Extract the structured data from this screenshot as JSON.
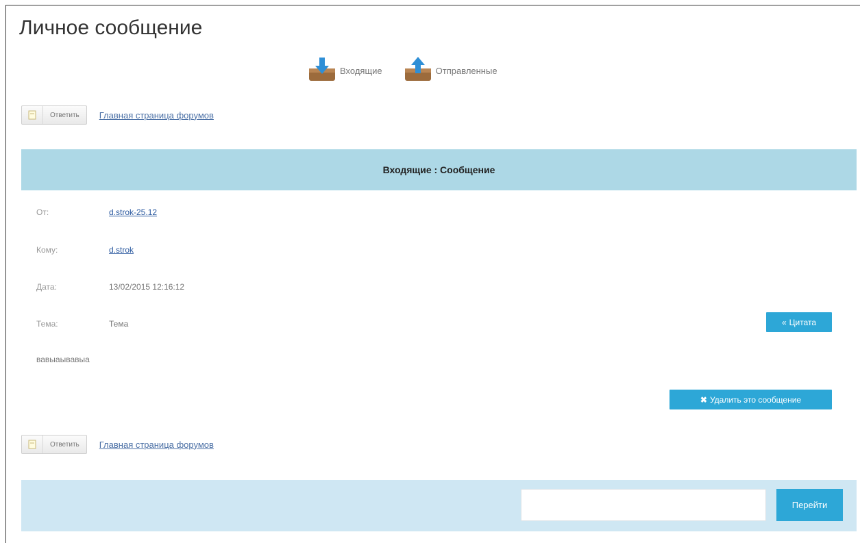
{
  "page": {
    "title": "Личное сообщение"
  },
  "folders": [
    {
      "label": "Входящие",
      "icon": "inbox-icon"
    },
    {
      "label": "Отправленные",
      "icon": "sent-icon"
    }
  ],
  "toolbar": {
    "reply_label": "Ответить",
    "forum_link": "Главная страница форумов"
  },
  "header": {
    "title": "Входящие : Сообщение"
  },
  "message": {
    "from_label": "От:",
    "from_value": "d.strok-25.12",
    "to_label": "Кому:",
    "to_value": "d.strok",
    "date_label": "Дата:",
    "date_value": "13/02/2015 12:16:12",
    "subject_label": "Тема:",
    "subject_value": "Тема",
    "body": "вавыаывавыа"
  },
  "buttons": {
    "quote_label": "Цитата",
    "delete_label": "Удалить это сообщение",
    "goto_label": "Перейти"
  },
  "colors": {
    "accent": "#2da7d7",
    "header_bg": "#add8e6",
    "footer_bg": "#cfe7f3",
    "link": "#2c5aa0"
  }
}
